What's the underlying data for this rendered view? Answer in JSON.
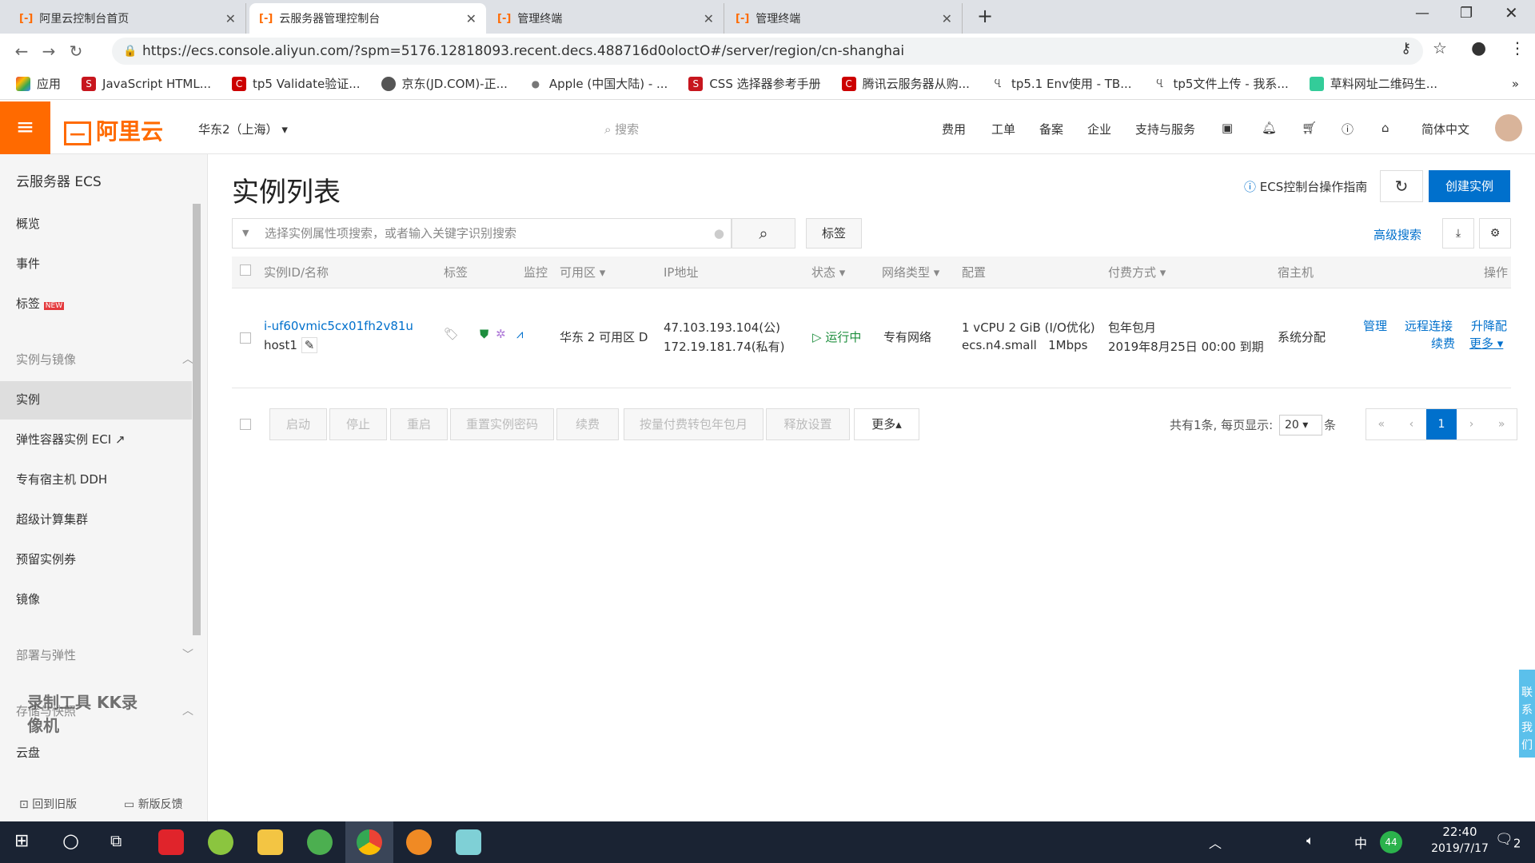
{
  "browser": {
    "tabs": [
      {
        "title": "阿里云控制台首页"
      },
      {
        "title": "云服务器管理控制台",
        "active": true
      },
      {
        "title": "管理终端"
      },
      {
        "title": "管理终端"
      }
    ],
    "url": "https://ecs.console.aliyun.com/?spm=5176.12818093.recent.decs.488716d0oloctO#/server/region/cn-shanghai",
    "bookmarks": [
      "应用",
      "JavaScript HTML...",
      "tp5 Validate验证...",
      "京东(JD.COM)-正...",
      "Apple (中国大陆) - ...",
      "CSS 选择器参考手册",
      "腾讯云服务器从购...",
      "tp5.1 Env使用 - TB...",
      "tp5文件上传 - 我系...",
      "草料网址二维码生..."
    ]
  },
  "header": {
    "logo": "阿里云",
    "region": "华东2（上海）",
    "search_placeholder": "搜索",
    "nav": [
      "费用",
      "工单",
      "备案",
      "企业",
      "支持与服务"
    ],
    "lang": "简体中文"
  },
  "sidebar": {
    "title": "云服务器 ECS",
    "items": [
      "概览",
      "事件",
      "标签"
    ],
    "new_badge": "NEW",
    "group1": "实例与镜像",
    "group1_items": [
      "实例",
      "弹性容器实例 ECI",
      "专有宿主机 DDH",
      "超级计算集群",
      "预留实例券",
      "镜像"
    ],
    "group2": "部署与弹性",
    "group3": "存储与快照",
    "group3_items": [
      "云盘"
    ],
    "footer_old": "回到旧版",
    "footer_feedback": "新版反馈",
    "watermark": "录制工具 KK录像机"
  },
  "main": {
    "title": "实例列表",
    "guide": "ECS控制台操作指南",
    "create": "创建实例",
    "search_placeholder": "选择实例属性项搜索，或者输入关键字识别搜索",
    "tag_btn": "标签",
    "advanced": "高级搜索",
    "columns": [
      "实例ID/名称",
      "标签",
      "监控",
      "可用区",
      "IP地址",
      "状态",
      "网络类型",
      "配置",
      "付费方式",
      "宿主机",
      "操作"
    ],
    "rows": [
      {
        "id": "i-uf60vmic5cx01fh2v81u",
        "name": "host1",
        "zone": "华东 2 可用区 D",
        "ip_public": "47.103.193.104(公)",
        "ip_private": "172.19.181.74(私有)",
        "status": "运行中",
        "network": "专有网络",
        "config1": "1 vCPU 2 GiB (I/O优化)",
        "config2": "ecs.n4.small   1Mbps",
        "pay1": "包年包月",
        "pay2": "2019年8月25日 00:00 到期",
        "host": "系统分配",
        "actions": [
          "管理",
          "远程连接",
          "升降配",
          "续费",
          "更多"
        ]
      }
    ],
    "bulk": [
      "启动",
      "停止",
      "重启",
      "重置实例密码",
      "续费",
      "按量付费转包年包月",
      "释放设置",
      "更多▴"
    ],
    "pager": {
      "total_text": "共有1条, 每页显示:",
      "page_size": "20",
      "unit": "条",
      "current": "1"
    }
  },
  "contact": "联系我们",
  "taskbar": {
    "time": "22:40",
    "date": "2019/7/17",
    "ime": "中",
    "notif": "2",
    "badge": "44"
  },
  "colors": {
    "brand": "#ff6a00",
    "primary": "#0070cc",
    "running": "#1e8e3e"
  }
}
